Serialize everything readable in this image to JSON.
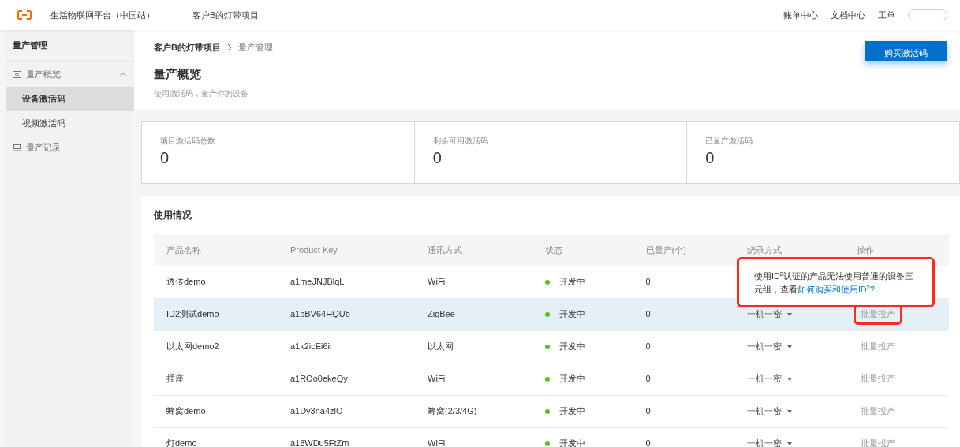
{
  "topbar": {
    "platform": "生活物联网平台（中国站）",
    "project": "客户B的灯带项目",
    "links": [
      "账单中心",
      "文档中心",
      "工单"
    ]
  },
  "sidebar": {
    "title": "量产管理",
    "items": [
      {
        "label": "量产概览",
        "expanded": true,
        "selected": false,
        "children": [
          {
            "label": "设备激活码",
            "selected": true
          },
          {
            "label": "视频激活码",
            "selected": false
          }
        ]
      },
      {
        "label": "量产记录",
        "selected": false
      }
    ]
  },
  "breadcrumb": [
    "客户B的灯带项目",
    "量产管理"
  ],
  "header": {
    "title": "量产概览",
    "subtitle": "使用激活码，量产你的设备",
    "button": "购买激活码"
  },
  "stats": [
    {
      "label": "项目激活码总数",
      "value": "0"
    },
    {
      "label": "剩余可用激活码",
      "value": "0"
    },
    {
      "label": "已量产激活码",
      "value": "0"
    }
  ],
  "usage": {
    "title": "使用情况",
    "columns": [
      "产品名称",
      "Product Key",
      "通讯方式",
      "状态",
      "已量产(个)",
      "烧录方式",
      "操作"
    ],
    "rows": [
      {
        "name": "透传demo",
        "key": "a1meJNJBlqL",
        "comm": "WiFi",
        "status": "开发中",
        "color": "#52c41a",
        "count": "0",
        "selected": false
      },
      {
        "name": "ID2测试demo",
        "key": "a1pBV64HQUb",
        "comm": "ZigBee",
        "status": "开发中",
        "color": "#52c41a",
        "count": "0",
        "burn": "一机一密",
        "action": "批量投产",
        "disabled": true,
        "highlighted": true,
        "selected": true
      },
      {
        "name": "以太网demo2",
        "key": "a1k2icEi6ir",
        "comm": "以太网",
        "status": "开发中",
        "color": "#52c41a",
        "count": "0",
        "burn": "一机一密",
        "action": "批量投产",
        "disabled": true,
        "highlighted": false,
        "selected": false
      },
      {
        "name": "插座",
        "key": "a1ROo0ekeQy",
        "comm": "WiFi",
        "status": "开发中",
        "color": "#52c41a",
        "count": "0",
        "burn": "一机一密",
        "action": "批量投产",
        "disabled": true,
        "highlighted": false,
        "selected": false
      },
      {
        "name": "蜂窝demo",
        "key": "a1Dy3na4zlO",
        "comm": "蜂窝(2/3/4G)",
        "status": "开发中",
        "color": "#52c41a",
        "count": "0",
        "burn": "一机一密",
        "action": "批量投产",
        "disabled": true,
        "highlighted": false,
        "selected": false
      },
      {
        "name": "灯demo",
        "key": "a18WDu5FtZm",
        "comm": "WiFi",
        "status": "开发中",
        "color": "#52c41a",
        "count": "0",
        "burn": "一机一密",
        "action": "批量投产",
        "disabled": true,
        "highlighted": false,
        "selected": false
      }
    ]
  },
  "tooltip": {
    "text": "使用ID$^{2}$认证的产品无法使用普通的设备三元组，查看",
    "link": "如何购买和使用ID$^{2}$?",
    "highlighted": true
  }
}
